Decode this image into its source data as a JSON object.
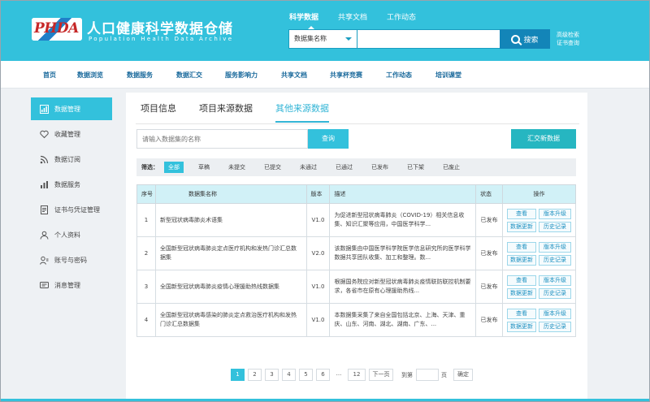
{
  "header": {
    "logo": "PHDA",
    "title": "人口健康科学数据仓储",
    "subtitle": "Population  Health  Data  Archive",
    "tabs": [
      "科学数据",
      "共享文档",
      "工作动态"
    ],
    "search_category": "数据集名称",
    "search_value": "",
    "search_button": "搜索",
    "advanced_search": "高级检索",
    "certificate_query": "证书查询"
  },
  "nav": [
    "首页",
    "数据浏览",
    "数据服务",
    "数据汇交",
    "服务影响力",
    "共享文档",
    "共享杯竞赛",
    "工作动态",
    "培训课堂"
  ],
  "sidebar": {
    "items": [
      {
        "label": "数据管理",
        "icon": "chart-grid-icon",
        "active": true
      },
      {
        "label": "收藏管理",
        "icon": "heart-icon"
      },
      {
        "label": "数据订阅",
        "icon": "rss-icon"
      },
      {
        "label": "数据服务",
        "icon": "bar-chart-icon"
      },
      {
        "label": "证书与凭证管理",
        "icon": "document-icon"
      },
      {
        "label": "个人资料",
        "icon": "user-icon"
      },
      {
        "label": "账号与密码",
        "icon": "account-icon"
      },
      {
        "label": "消息管理",
        "icon": "message-icon"
      }
    ]
  },
  "content": {
    "tabs": [
      "项目信息",
      "项目来源数据",
      "其他来源数据"
    ],
    "active_tab": 2,
    "name_input_placeholder": "请输入数据集的名称",
    "query_button": "查询",
    "submit_button": "汇交新数据",
    "filter": {
      "label": "筛选：",
      "options": [
        "全部",
        "草稿",
        "未提交",
        "已提交",
        "未通过",
        "已通过",
        "已发布",
        "已下架",
        "已废止"
      ],
      "active": 0
    },
    "table": {
      "headers": [
        "序号",
        "数据集名称",
        "版本",
        "描述",
        "状态",
        "操作"
      ],
      "rows": [
        {
          "no": "1",
          "name": "新型冠状病毒肺炎术语集",
          "version": "V1.0",
          "desc": "为促进新型冠状病毒肺炎（COVID-19）相关信息收集、知识汇聚等应用，中国医学科学...",
          "status": "已发布"
        },
        {
          "no": "2",
          "name": "全国新型冠状病毒肺炎定点医疗机构和发热门诊汇总数据集",
          "version": "V2.0",
          "desc": "该数据集由中国医学科学院医学信息研究所的医学科学数据共享团队收集、加工和整理。数...",
          "status": "已发布"
        },
        {
          "no": "3",
          "name": "全国新型冠状病毒肺炎疫情心理援助热线数据集",
          "version": "V1.0",
          "desc": "根据国务院应对新型冠状病毒肺炎疫情联防联控机制要求，各省市在原有心理援助热线...",
          "status": "已发布"
        },
        {
          "no": "4",
          "name": "全国新型冠状病毒感染的肺炎定点救治医疗机构和发热门诊汇总数据集",
          "version": "V1.0",
          "desc": "本数据集采集了来自全国包括北京、上海、天津、重庆、山东、河南、湖北、湖南、广东、...",
          "status": "已发布"
        }
      ],
      "ops": [
        "查看",
        "版本升级",
        "数据更新",
        "历史记录"
      ]
    },
    "pager": {
      "pages": [
        "1",
        "2",
        "3",
        "4",
        "5",
        "6",
        "...",
        "12"
      ],
      "active": "1",
      "next": "下一页",
      "goto_label": "到第",
      "page_unit": "页",
      "confirm": "确定"
    }
  },
  "colors": {
    "accent": "#33c1dc",
    "header": "#33c1dc",
    "submit": "#26b6c1",
    "search_btn": "#1385b8"
  }
}
